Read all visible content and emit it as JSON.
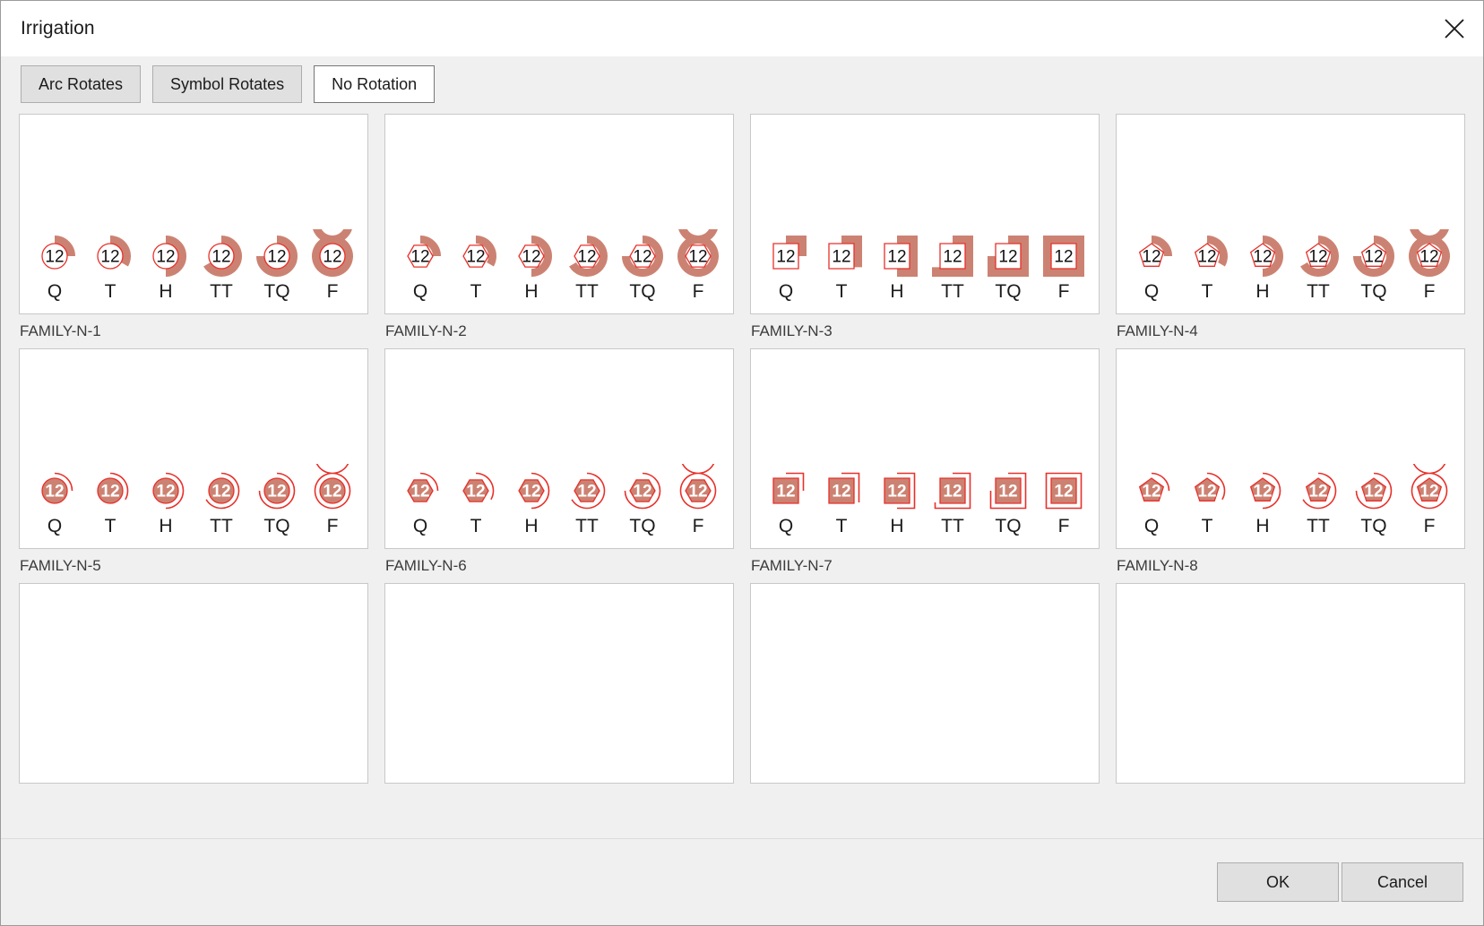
{
  "window": {
    "title": "Irrigation",
    "close_icon": "close-icon"
  },
  "tabs": [
    {
      "label": "Arc Rotates",
      "selected": false
    },
    {
      "label": "Symbol Rotates",
      "selected": false
    },
    {
      "label": "No Rotation",
      "selected": true
    }
  ],
  "colors": {
    "arc_fill": "#cc8272",
    "outline_red": "#e8302a",
    "panel_bg": "#f0f0f0",
    "preview_bg": "#ffffff",
    "border": "#c8c8c8",
    "text": "#1b1b1b",
    "label_text": "#3b3b3b"
  },
  "arc_types": [
    {
      "code": "Q",
      "label": "Q",
      "degrees": 90
    },
    {
      "code": "T",
      "label": "T",
      "degrees": 120
    },
    {
      "code": "H",
      "label": "H",
      "degrees": 180
    },
    {
      "code": "TT",
      "label": "TT",
      "degrees": 240
    },
    {
      "code": "TQ",
      "label": "TQ",
      "degrees": 270
    },
    {
      "code": "F",
      "label": "F",
      "degrees": 360
    }
  ],
  "symbol_text": "12",
  "families": [
    {
      "name": "FAMILY-N-1",
      "shape": "circle",
      "filled": false,
      "arc_style": "thick",
      "arc_shape": "round",
      "empty": false
    },
    {
      "name": "FAMILY-N-2",
      "shape": "hexagon",
      "filled": false,
      "arc_style": "thick",
      "arc_shape": "round",
      "empty": false
    },
    {
      "name": "FAMILY-N-3",
      "shape": "square",
      "filled": false,
      "arc_style": "thick",
      "arc_shape": "square",
      "empty": false
    },
    {
      "name": "FAMILY-N-4",
      "shape": "pentagon",
      "filled": false,
      "arc_style": "thick",
      "arc_shape": "round",
      "empty": false
    },
    {
      "name": "FAMILY-N-5",
      "shape": "circle",
      "filled": true,
      "arc_style": "thin",
      "arc_shape": "round",
      "empty": false
    },
    {
      "name": "FAMILY-N-6",
      "shape": "hexagon",
      "filled": true,
      "arc_style": "thin",
      "arc_shape": "round",
      "empty": false
    },
    {
      "name": "FAMILY-N-7",
      "shape": "square",
      "filled": true,
      "arc_style": "thin",
      "arc_shape": "square",
      "empty": false
    },
    {
      "name": "FAMILY-N-8",
      "shape": "pentagon",
      "filled": true,
      "arc_style": "thin",
      "arc_shape": "round",
      "empty": false
    },
    {
      "name": "",
      "shape": "",
      "filled": false,
      "arc_style": "",
      "arc_shape": "",
      "empty": true
    },
    {
      "name": "",
      "shape": "",
      "filled": false,
      "arc_style": "",
      "arc_shape": "",
      "empty": true
    },
    {
      "name": "",
      "shape": "",
      "filled": false,
      "arc_style": "",
      "arc_shape": "",
      "empty": true
    },
    {
      "name": "",
      "shape": "",
      "filled": false,
      "arc_style": "",
      "arc_shape": "",
      "empty": true
    }
  ],
  "footer": {
    "ok_label": "OK",
    "cancel_label": "Cancel"
  }
}
